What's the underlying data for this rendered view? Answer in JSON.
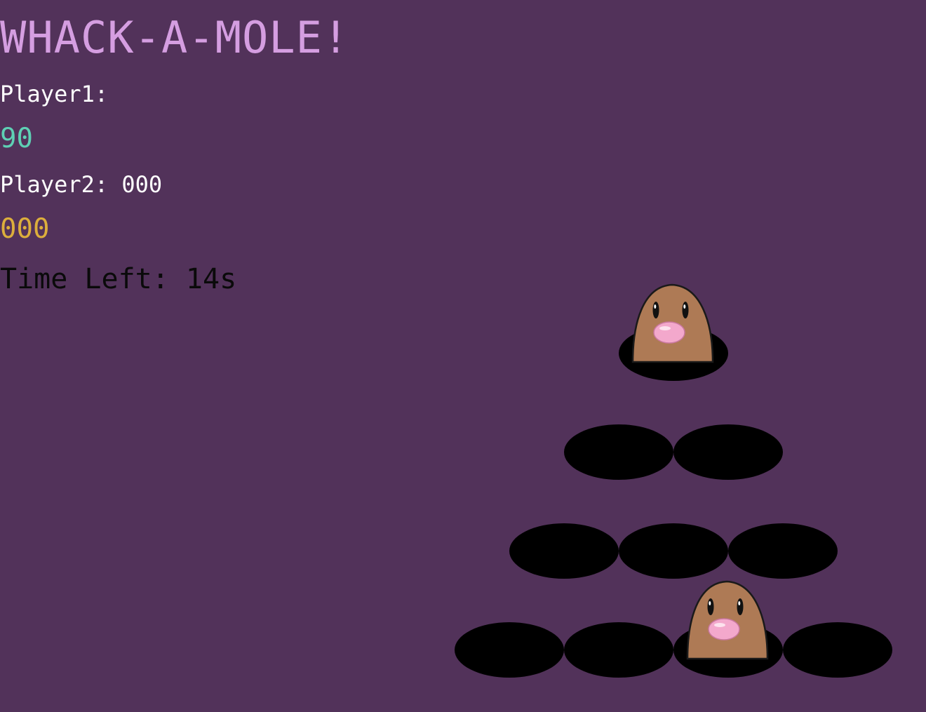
{
  "game": {
    "title": "WHACK-A-MOLE!",
    "player1_label": "Player1:",
    "player1_score": "90",
    "player2_label": "Player2: 000",
    "player2_score": "000",
    "time_left": "Time Left: 14s"
  },
  "board": {
    "rows": [
      1,
      2,
      3,
      4
    ],
    "active_moles": [
      {
        "row": 1,
        "col": 1
      },
      {
        "row": 4,
        "col": 3
      }
    ]
  },
  "colors": {
    "background": "#52325a",
    "title": "#d59ee1",
    "player1_score": "#5ed0b4",
    "player2_score": "#dcae3c",
    "timer": "#0a0a0a",
    "hole": "#000000",
    "mole_body": "#ae7a55",
    "mole_nose": "#f3a8cc"
  }
}
